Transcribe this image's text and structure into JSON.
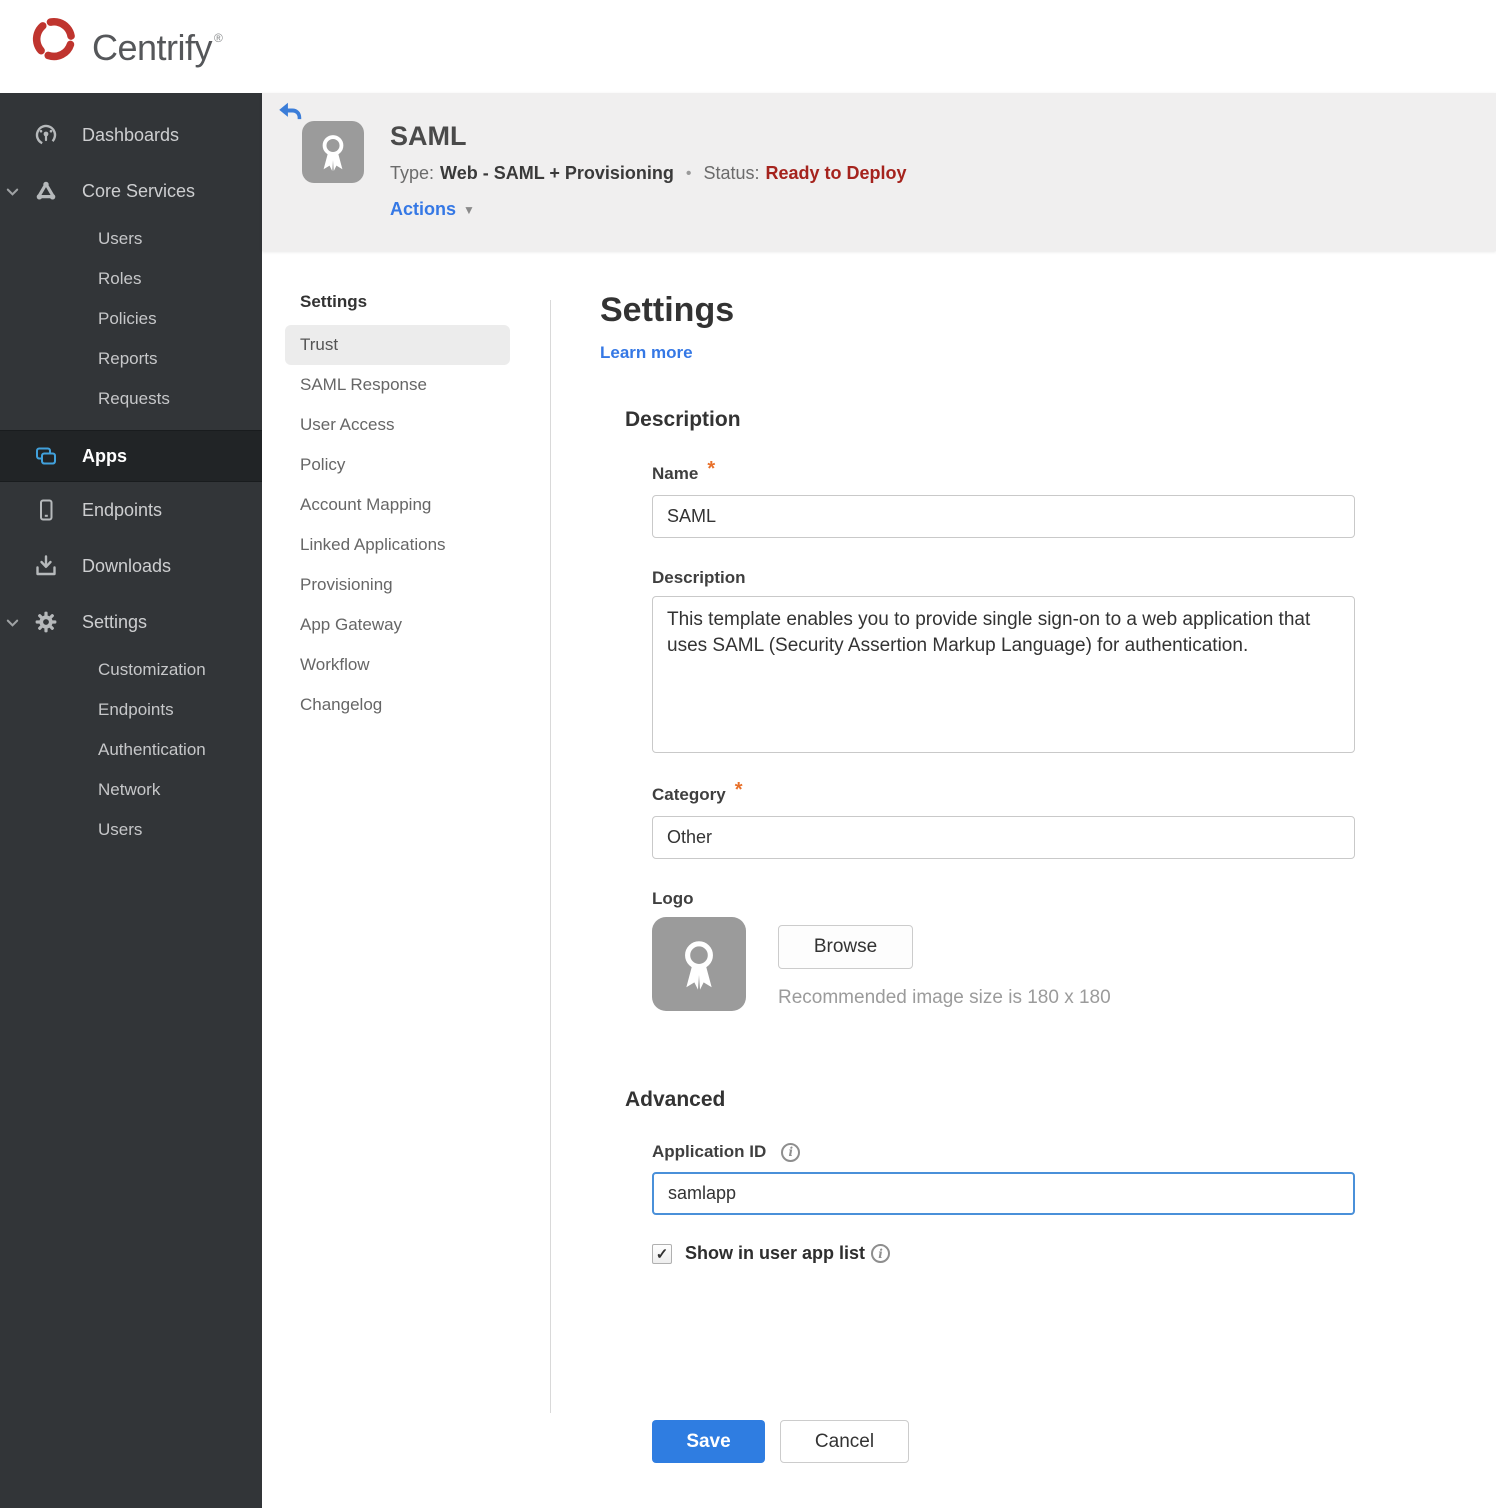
{
  "glyphs": {
    "required": "*",
    "bullet": "•",
    "caret": "▼",
    "info": "i",
    "check": "✓",
    "registered": "®"
  },
  "brand": {
    "name": "Centrify"
  },
  "sidebar": {
    "items": [
      {
        "label": "Dashboards"
      },
      {
        "label": "Core Services",
        "expanded": true,
        "children": [
          "Users",
          "Roles",
          "Policies",
          "Reports",
          "Requests"
        ]
      },
      {
        "label": "Apps",
        "selected": true
      },
      {
        "label": "Endpoints"
      },
      {
        "label": "Downloads"
      },
      {
        "label": "Settings",
        "expanded": true,
        "children": [
          "Customization",
          "Endpoints",
          "Authentication",
          "Network",
          "Users"
        ]
      }
    ]
  },
  "app_header": {
    "title": "SAML",
    "type_label": "Type:",
    "type_value": "Web - SAML + Provisioning",
    "status_label": "Status:",
    "status_value": "Ready to Deploy",
    "actions_label": "Actions"
  },
  "subnav": {
    "header": "Settings",
    "selected": "Trust",
    "items": [
      "Trust",
      "SAML Response",
      "User Access",
      "Policy",
      "Account Mapping",
      "Linked Applications",
      "Provisioning",
      "App Gateway",
      "Workflow",
      "Changelog"
    ]
  },
  "main": {
    "title": "Settings",
    "learn_more_label": "Learn more",
    "description": {
      "heading": "Description",
      "name_label": "Name",
      "name_value": "SAML",
      "description_label": "Description",
      "description_value": "This template enables you to provide single sign-on to a web application that uses SAML (Security Assertion Markup Language) for authentication.",
      "category_label": "Category",
      "category_value": "Other",
      "logo_label": "Logo",
      "browse_label": "Browse",
      "logo_hint": "Recommended image size is 180 x 180"
    },
    "advanced": {
      "heading": "Advanced",
      "application_id_label": "Application ID",
      "application_id_value": "samlapp",
      "show_in_user_app_list_label": "Show in user app list",
      "checkbox_checked": true
    },
    "footer": {
      "save_label": "Save",
      "cancel_label": "Cancel"
    }
  },
  "colors": {
    "accent_blue": "#3578e5",
    "apps_icon_blue": "#41a1dc",
    "status_red": "#a5231d",
    "save_blue": "#2f7de1",
    "required_orange": "#e8702a",
    "sidebar_bg": "#323538",
    "sidebar_selected_bg": "#212426",
    "header_band_bg": "#f0efef"
  }
}
